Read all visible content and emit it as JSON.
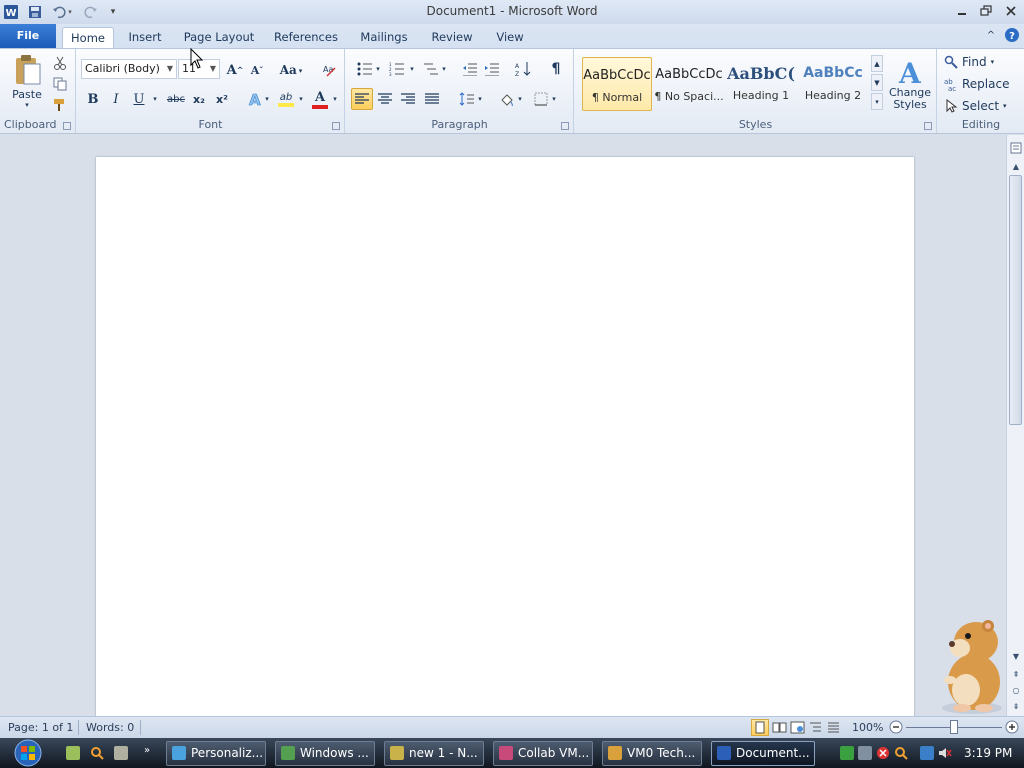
{
  "title": "Document1 - Microsoft Word",
  "tabs": [
    "File",
    "Home",
    "Insert",
    "Page Layout",
    "References",
    "Mailings",
    "Review",
    "View"
  ],
  "active_tab": "Home",
  "clipboard": {
    "paste_label": "Paste",
    "group_label": "Clipboard"
  },
  "font": {
    "family": "Calibri (Body)",
    "size": "11",
    "group_label": "Font",
    "grow": "A",
    "shrink": "A",
    "change_case": "Aa",
    "bold": "B",
    "italic": "I",
    "underline": "U",
    "strike": "abc",
    "subscript": "x₂",
    "superscript": "x²",
    "highlight": "ab",
    "font_color": "A"
  },
  "paragraph": {
    "group_label": "Paragraph",
    "show_marks": "¶"
  },
  "styles": {
    "group_label": "Styles",
    "items": [
      {
        "sample": "AaBbCcDc",
        "name": "¶ Normal"
      },
      {
        "sample": "AaBbCcDc",
        "name": "¶ No Spaci..."
      },
      {
        "sample": "AaBbC(",
        "name": "Heading 1"
      },
      {
        "sample": "AaBbCc",
        "name": "Heading 2"
      }
    ],
    "change_styles": "Change Styles"
  },
  "editing": {
    "group_label": "Editing",
    "find": "Find",
    "replace": "Replace",
    "select": "Select"
  },
  "status": {
    "page": "Page: 1 of 1",
    "words": "Words: 0",
    "zoom": "100%"
  },
  "taskbar": {
    "items": [
      {
        "label": "Personaliz...",
        "color": "#4aa3df"
      },
      {
        "label": "Windows ...",
        "color": "#55a050"
      },
      {
        "label": "new 1 - N...",
        "color": "#c9b24a"
      },
      {
        "label": "Collab VM...",
        "color": "#c84a7a"
      },
      {
        "label": "VM0 Tech...",
        "color": "#d9a03b"
      },
      {
        "label": "Document...",
        "color": "#2b5fb8"
      }
    ],
    "clock": "3:19 PM"
  },
  "colors": {
    "accent": "#2b579a",
    "file_tab": "#2a6dc9",
    "highlight": "#ffe94a",
    "font_color": "#e02020"
  }
}
